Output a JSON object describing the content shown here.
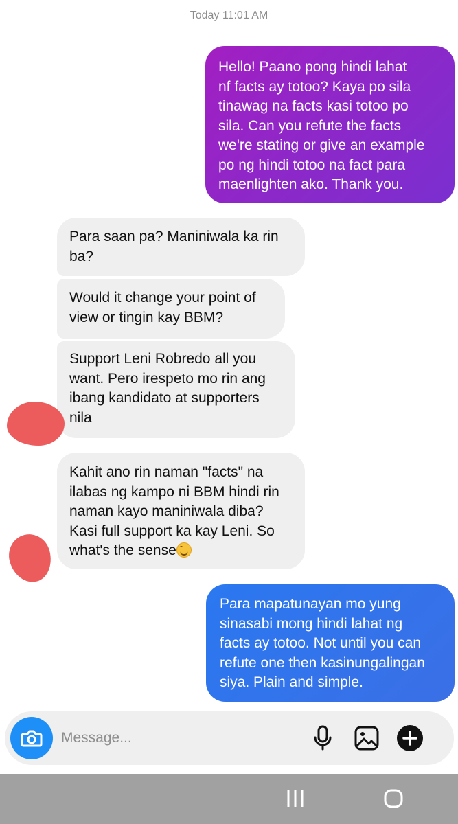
{
  "thread": {
    "timestamp": "Today 11:01 AM",
    "messages": [
      {
        "side": "outgoing",
        "text": "Hello! Paano pong hindi lahat\nnf facts ay totoo? Kaya po sila\ntinawag na facts kasi totoo po\nsila. Can you refute the facts\nwe're stating or give an example\npo ng hindi totoo na fact para\nmaenlighten ako. Thank you."
      },
      {
        "side": "incoming",
        "text": "Para saan pa? Maniniwala ka rin\nba?"
      },
      {
        "side": "incoming",
        "text": "Would it change your point of\nview or tingin kay BBM?"
      },
      {
        "side": "incoming",
        "text": "Support Leni Robredo all you\nwant. Pero irespeto mo rin ang\nibang kandidato at supporters\nnila"
      },
      {
        "side": "incoming",
        "text": "Kahit ano rin naman \"facts\" na\nilabas ng kampo ni BBM hindi rin\nnaman kayo maniniwala diba?\nKasi full support ka kay Leni. So\nwhat's the sense",
        "emoji": "smiling-face-emoji"
      },
      {
        "side": "outgoing",
        "text": "Para mapatunayan mo yung\nsinasabi mong hindi lahat ng\nfacts ay totoo. Not until you can\nrefute one then kasinungalingan\nsiya. Plain and simple."
      }
    ]
  },
  "composer": {
    "placeholder": "Message...",
    "icons": [
      "camera-icon",
      "microphone-icon",
      "image-icon",
      "plus-icon"
    ]
  },
  "navbar": {
    "icons": [
      "recent-apps-icon",
      "home-icon"
    ]
  },
  "colors": {
    "outgoing_purple": "#8f27c8",
    "outgoing_blue": "#2f74ec",
    "incoming_gray": "#efefef",
    "camera_blue": "#1e8ff7",
    "redaction": "#ec5c5c",
    "navbar": "#a1a1a1"
  }
}
